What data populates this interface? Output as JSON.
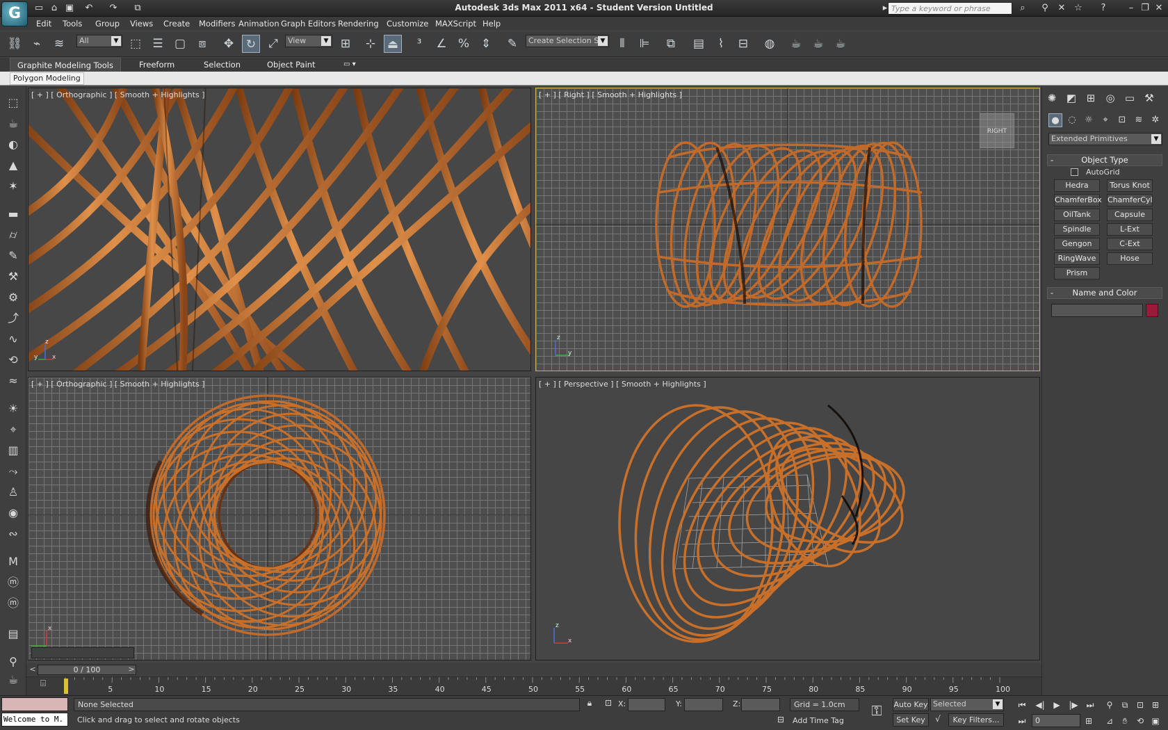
{
  "window": {
    "title": "Autodesk 3ds Max  2011 x64  - Student Version   Untitled",
    "search_placeholder": "Type a keyword or phrase"
  },
  "app_logo_glyph": "G",
  "menu": [
    "Edit",
    "Tools",
    "Group",
    "Views",
    "Create",
    "Modifiers",
    "Animation",
    "Graph Editors",
    "Rendering",
    "Customize",
    "MAXScript",
    "Help"
  ],
  "toolbar": {
    "selection_filter": "All",
    "ref_coord": "View",
    "named_selection": "Create Selection Se"
  },
  "ribbon": {
    "tabs": [
      "Graphite Modeling Tools",
      "Freeform",
      "Selection",
      "Object Paint"
    ],
    "panel_label": "Polygon Modeling"
  },
  "viewports": [
    {
      "label": "[ + ] [ Orthographic ] [ Smooth + Highlights ]"
    },
    {
      "label": "[ + ] [ Right ] [ Smooth + Highlights ]"
    },
    {
      "label": "[ + ] [ Orthographic ] [ Smooth + Highlights ]"
    },
    {
      "label": "[ + ] [ Perspective ] [ Smooth + Highlights ]"
    }
  ],
  "viewcube_label": "RIGHT",
  "axis_labels": {
    "x": "x",
    "y": "y",
    "z": "z"
  },
  "command_panel": {
    "category": "Extended Primitives",
    "object_type_header": "Object Type",
    "autogrid_label": "AutoGrid",
    "primitives": [
      "Hedra",
      "Torus Knot",
      "ChamferBox",
      "ChamferCyl",
      "OilTank",
      "Capsule",
      "Spindle",
      "L-Ext",
      "Gengon",
      "C-Ext",
      "RingWave",
      "Hose",
      "Prism"
    ],
    "name_color_header": "Name and Color",
    "object_color": "#9b1a3a",
    "rollout_minus": "-"
  },
  "timeline": {
    "frame_display": "0 / 100",
    "prev_arrow": "<",
    "next_arrow": ">",
    "ticks": [
      "5",
      "10",
      "15",
      "20",
      "25",
      "30",
      "35",
      "40",
      "45",
      "50",
      "55",
      "60",
      "65",
      "70",
      "75",
      "80",
      "85",
      "90",
      "95",
      "100"
    ]
  },
  "status": {
    "listener_text": "Welcome to M.",
    "selection_status": "None Selected",
    "prompt": "Click and drag to select and rotate objects",
    "x_label": "X:",
    "y_label": "Y:",
    "z_label": "Z:",
    "grid": "Grid = 1.0cm",
    "add_time_tag": "Add Time Tag",
    "auto_key": "Auto Key",
    "set_key": "Set Key",
    "key_mode": "Selected",
    "key_filters": "Key Filters...",
    "current_frame": "0"
  },
  "colors": {
    "accent": "#6fb7c9",
    "object": "#c8702a",
    "viewport_bg": "#4e4e4e",
    "grid": "#767676",
    "active_border": "#c9b04a"
  }
}
